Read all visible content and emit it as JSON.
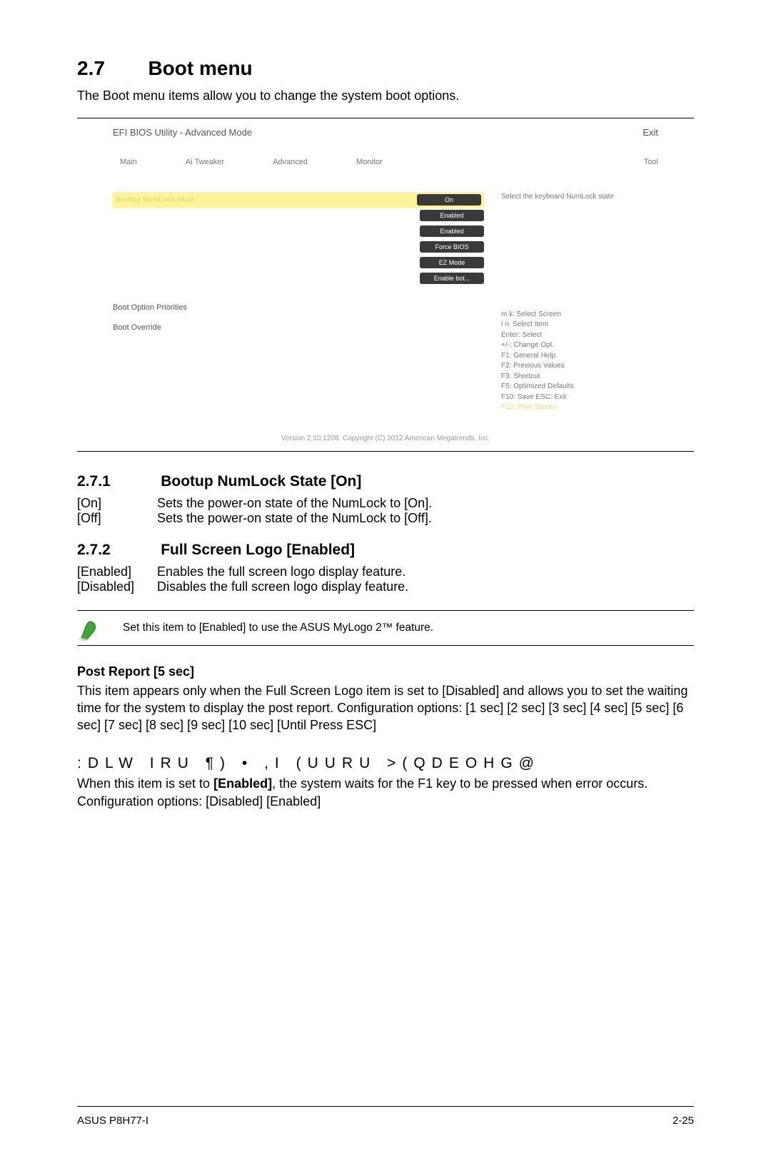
{
  "heading": {
    "num": "2.7",
    "title": "Boot menu"
  },
  "intro": "The Boot menu items allow you to change the system boot options.",
  "bios": {
    "title": "EFI BIOS Utility - Advanced Mode",
    "exit": "Exit",
    "nav": {
      "main": "Main",
      "ai": "Ai Tweaker",
      "adv": "Advanced",
      "mon": "Monitor",
      "tool": "Tool"
    },
    "help": "Select the keyboard NumLock state",
    "row_hl": "Bootup NumLock State",
    "pills": {
      "p1": "On",
      "p2": "Enabled",
      "p3": "Enabled",
      "p4": "Force BIOS",
      "p5": "EZ Mode",
      "p6": "Enable bot..."
    },
    "section1": "Boot Option Priorities",
    "section2": "Boot Override",
    "keys": {
      "l1": "m k: Select Screen",
      "l2": "l n: Select Item",
      "l3": "Enter: Select",
      "l4": "+/-: Change Opt.",
      "l5": "F1: General Help",
      "l6": "F2: Previous Values",
      "l7": "F3: Shortcut",
      "l8": "F5: Optimized Defaults",
      "l9": "F10: Save  ESC: Exit",
      "l10": "F12: Print Screen"
    },
    "footer": "Version 2.10.1208.  Copyright (C) 2012 American Megatrends, Inc."
  },
  "s271": {
    "num": "2.7.1",
    "title": "Bootup NumLock State [On]",
    "opts": [
      {
        "k": "[On]",
        "v": "Sets the power-on state of the NumLock to [On]."
      },
      {
        "k": "[Off]",
        "v": "Sets the power-on state of the NumLock to [Off]."
      }
    ]
  },
  "s272": {
    "num": "2.7.2",
    "title": "Full Screen Logo [Enabled]",
    "opts": [
      {
        "k": "[Enabled]",
        "v": "Enables the full screen logo display feature."
      },
      {
        "k": "[Disabled]",
        "v": "Disables the full screen logo display feature."
      }
    ]
  },
  "note": "Set this item to [Enabled] to use the ASUS MyLogo 2™ feature.",
  "post": {
    "title": "Post Report [5 sec]",
    "body": "This item appears only when the Full Screen Logo item is set to [Disabled] and allows you to set the waiting time for the system to display the post report. Configuration options: [1 sec] [2 sec] [3 sec] [4 sec] [5 sec] [6 sec] [7 sec] [8 sec] [9 sec] [10 sec] [Until Press ESC]"
  },
  "garbled": ":DLW IRU ¶) • ,I (UURU >(QDEOHG@",
  "wait_body_pre": "When this item is set to ",
  "wait_body_bold": "[Enabled]",
  "wait_body_post": ", the system waits for the F1 key to be pressed when error occurs. Configuration options: [Disabled] [Enabled]",
  "footer": {
    "left": "ASUS P8H77-I",
    "right": "2-25"
  }
}
